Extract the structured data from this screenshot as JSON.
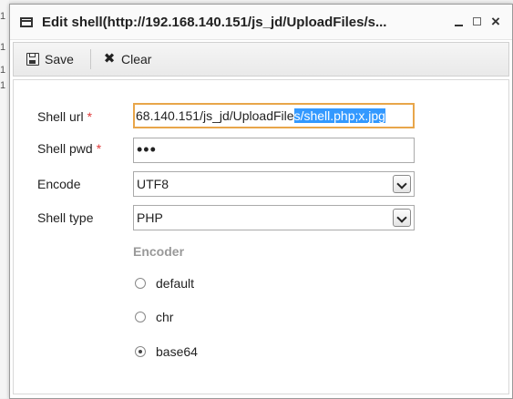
{
  "background": {
    "edge_chars": [
      "1",
      "1",
      "1",
      "1"
    ]
  },
  "window": {
    "title": "Edit shell(http://192.168.140.151/js_jd/UploadFiles/s...",
    "controls": {
      "minimize": "minimize",
      "maximize": "maximize",
      "close": "×"
    }
  },
  "toolbar": {
    "save_label": "Save",
    "clear_label": "Clear"
  },
  "form": {
    "shell_url": {
      "label": "Shell url",
      "required_mark": "*",
      "value_prefix": "68.140.151/js_jd/UploadFile",
      "value_selected": "s/shell.php;x.jpg"
    },
    "shell_pwd": {
      "label": "Shell pwd",
      "required_mark": "*",
      "value_masked": "•••"
    },
    "encode": {
      "label": "Encode",
      "selected": "UTF8"
    },
    "shell_type": {
      "label": "Shell type",
      "selected": "PHP"
    },
    "encoder": {
      "title": "Encoder",
      "options": [
        {
          "label": "default",
          "checked": false
        },
        {
          "label": "chr",
          "checked": false
        },
        {
          "label": "base64",
          "checked": true
        }
      ]
    }
  },
  "colors": {
    "required": "#e03b3b",
    "focus_border": "#e8a64a",
    "selection": "#3399ff",
    "section_title": "#999999"
  }
}
